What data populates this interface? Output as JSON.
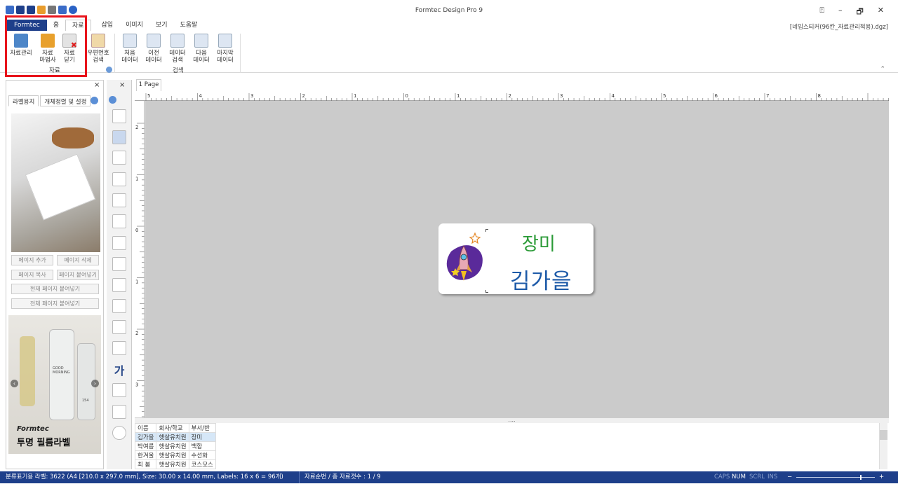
{
  "app": {
    "title": "Formtec Design Pro 9",
    "document": "[네임스티커(96칸_자료관리적용).dgz]"
  },
  "ribbon_tabs": [
    "Formtec",
    "홈",
    "자료",
    "삽입",
    "이미지",
    "보기",
    "도움말"
  ],
  "ribbon": {
    "buttons": [
      {
        "l1": "자료관리",
        "l2": ""
      },
      {
        "l1": "자료",
        "l2": "마법사"
      },
      {
        "l1": "자료",
        "l2": "닫기"
      },
      {
        "l1": "우편번호",
        "l2": "검색"
      },
      {
        "l1": "처음",
        "l2": "데이터"
      },
      {
        "l1": "이전",
        "l2": "데이터"
      },
      {
        "l1": "데이터",
        "l2": "검색"
      },
      {
        "l1": "다음",
        "l2": "데이터"
      },
      {
        "l1": "마지막",
        "l2": "데이터"
      }
    ],
    "group_data": "자료",
    "group_search": "검색"
  },
  "left_panel": {
    "tabs": [
      "라벨용지",
      "개체정렬 및 설정"
    ],
    "buttons": [
      "페이지 추가",
      "페이지 삭제",
      "페이지 복사",
      "페이지 붙여넣기",
      "현재 페이지 붙여넣기",
      "전체 페이지 붙여넣기"
    ],
    "ad": {
      "brand": "Formtec",
      "product": "투명 필름라벨",
      "bottle_text": "GOOD MORNING",
      "bottle_num": "154"
    }
  },
  "page_tab": "1 Page",
  "ruler": {
    "h": [
      "5",
      "4",
      "3",
      "2",
      "1",
      "0",
      "1",
      "2",
      "3",
      "4",
      "5",
      "6",
      "7",
      "8"
    ],
    "v": [
      "2",
      "1",
      "0",
      "1",
      "2",
      "3"
    ]
  },
  "label": {
    "line1": "장미",
    "line2": "김가을"
  },
  "grid": {
    "headers": [
      "이름",
      "회사/학교",
      "부서/반"
    ],
    "rows": [
      [
        "김가을",
        "햇살유치원",
        "장미"
      ],
      [
        "박여름",
        "햇살유치원",
        "백합"
      ],
      [
        "한겨울",
        "햇살유치원",
        "수선화"
      ],
      [
        "최 봄",
        "햇살유치원",
        "코스모스"
      ]
    ]
  },
  "status": {
    "left": "분류표기용 라벨: 3622 (A4 [210.0 x 297.0 mm], Size: 30.00 x 14.00 mm,  Labels: 16 x 6 = 96개)",
    "center": "자료순번 / 총 자료갯수 : 1 / 9",
    "caps": "CAPS",
    "num": "NUM",
    "scrl": "SCRL",
    "ins": "INS",
    "minus": "−",
    "plus": "+"
  },
  "window_controls": [
    "⍐",
    "–",
    "🗗",
    "✕"
  ],
  "close_x": "×"
}
